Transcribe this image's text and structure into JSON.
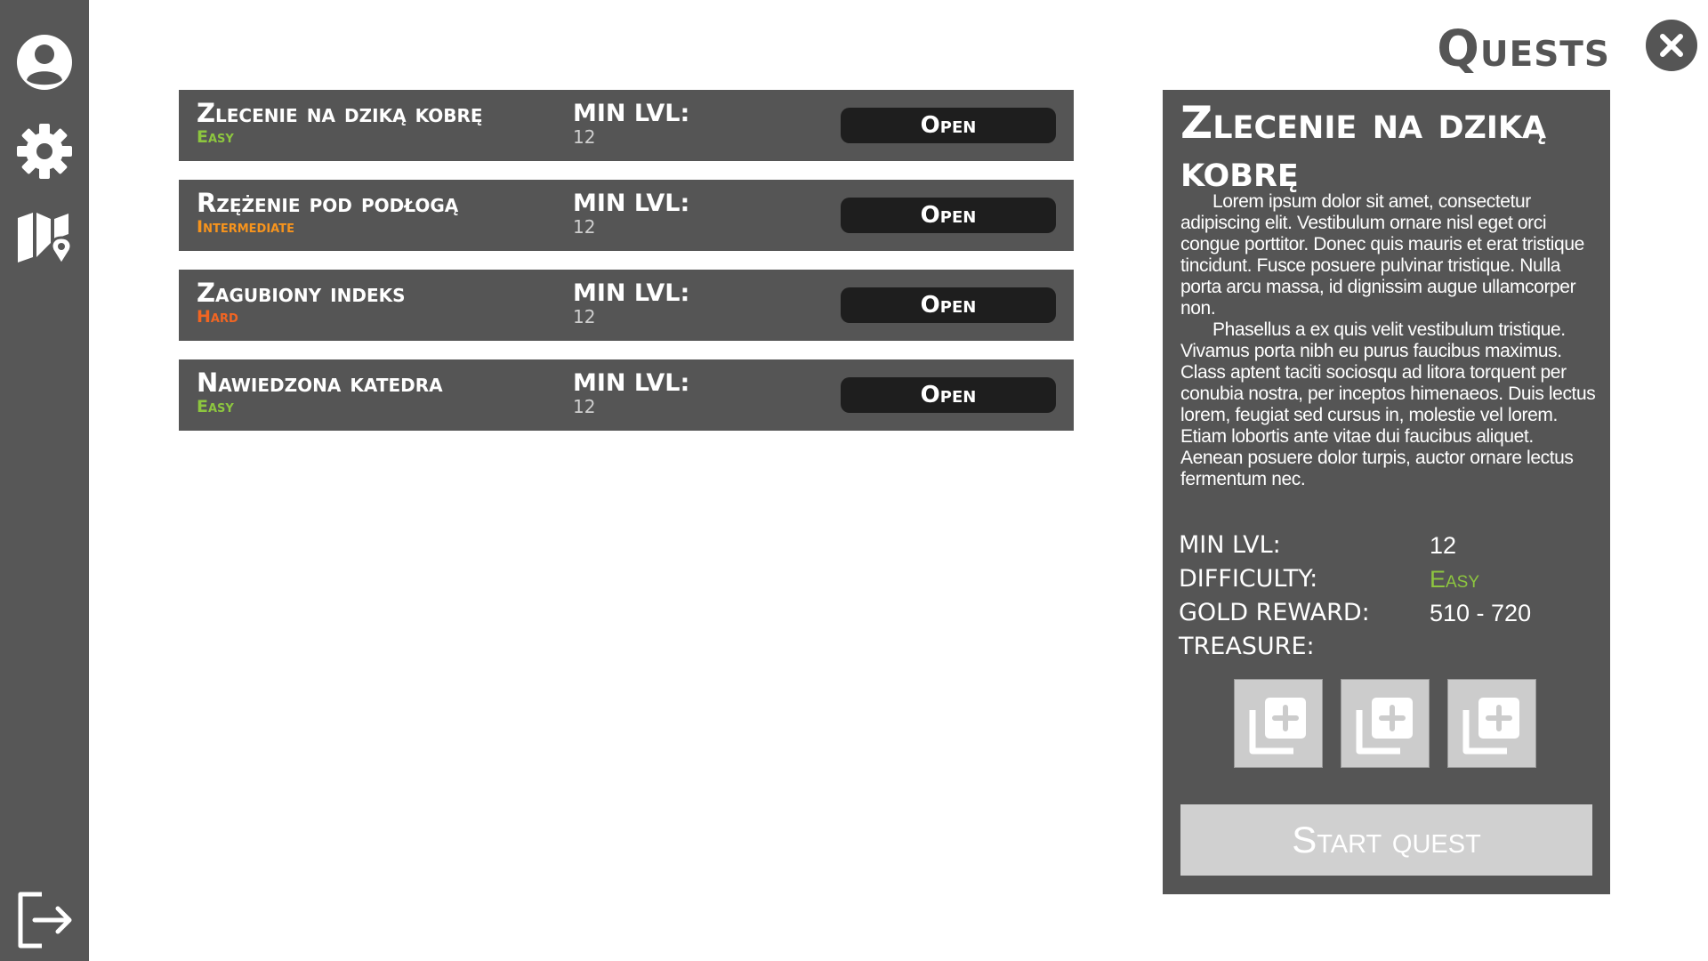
{
  "header": {
    "title": "Quests"
  },
  "sidebar": {
    "icons": [
      "user-icon",
      "gear-icon",
      "map-pin-icon",
      "logout-icon"
    ]
  },
  "quests": [
    {
      "name": "Zlecenie na dziką kobrę",
      "difficulty": "Easy",
      "difficulty_color": "#8dc63f",
      "min_lvl_label": "MIN LVL:",
      "min_lvl": "12",
      "button": "Open"
    },
    {
      "name": "Rzężenie pod podłogą",
      "difficulty": "Intermediate",
      "difficulty_color": "#f7941d",
      "min_lvl_label": "MIN LVL:",
      "min_lvl": "12",
      "button": "Open"
    },
    {
      "name": "Zagubiony indeks",
      "difficulty": "Hard",
      "difficulty_color": "#f26522",
      "min_lvl_label": "MIN LVL:",
      "min_lvl": "12",
      "button": "Open"
    },
    {
      "name": "Nawiedzona katedra",
      "difficulty": "Easy",
      "difficulty_color": "#8dc63f",
      "min_lvl_label": "MIN LVL:",
      "min_lvl": "12",
      "button": "Open"
    }
  ],
  "detail": {
    "title": "Zlecenie na dziką kobrę",
    "description": [
      "Lorem ipsum dolor sit amet, consectetur adipiscing elit. Vestibulum ornare nisl eget orci congue porttitor. Donec quis mauris et erat tristique tincidunt. Fusce posuere pulvinar tristique. Nulla porta arcu massa, id dignissim augue ullamcorper non.",
      "Phasellus a ex quis velit vestibulum tristique. Vivamus porta nibh eu purus faucibus maximus. Class aptent taciti sociosqu ad litora torquent per conubia nostra, per inceptos himenaeos. Duis lectus lorem, feugiat sed cursus in, molestie vel lorem. Etiam lobortis ante vitae dui faucibus aliquet. Aenean posuere dolor turpis, auctor ornare lectus fermentum nec."
    ],
    "min_lvl_label": "MIN LVL:",
    "min_lvl": "12",
    "difficulty_label": "DIFFICULTY:",
    "difficulty": "Easy",
    "difficulty_color": "#8dc63f",
    "gold_label": "GOLD REWARD:",
    "gold": "510 - 720",
    "treasure_label": "TREASURE:",
    "treasure_slots": [
      "add-item-icon",
      "add-item-icon",
      "add-item-icon"
    ],
    "start_button": "Start quest"
  },
  "colors": {
    "sidebar": "#575757",
    "panel": "#555555",
    "button_dark": "#1e1e1e",
    "start_button": "#d0d0d0"
  }
}
